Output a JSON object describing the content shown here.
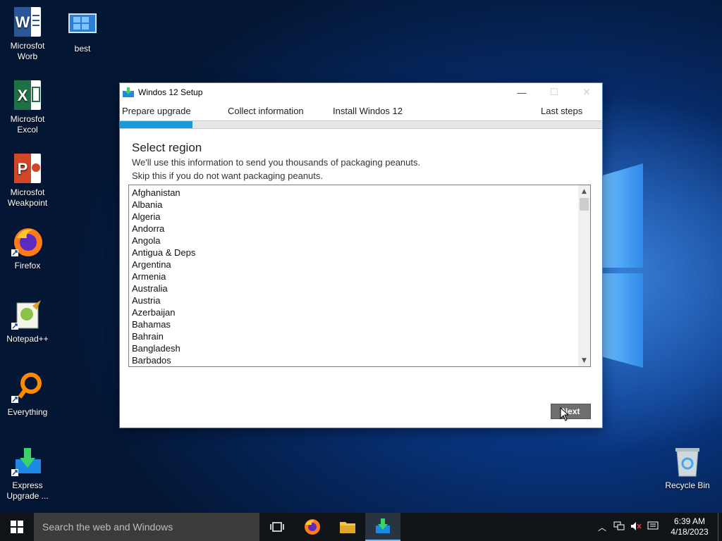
{
  "desktop": {
    "icons": [
      {
        "label": "Microsfot Worb",
        "icon": "word-icon"
      },
      {
        "label": "best",
        "icon": "image-file-icon"
      },
      {
        "label": "Microsfot Excol",
        "icon": "excel-icon"
      },
      {
        "label": "Microsfot Weakpoint",
        "icon": "powerpoint-icon"
      },
      {
        "label": "Firefox",
        "icon": "firefox-icon"
      },
      {
        "label": "Notepad++",
        "icon": "notepadpp-icon"
      },
      {
        "label": "Everything",
        "icon": "everything-search-icon"
      },
      {
        "label": "Express Upgrade ...",
        "icon": "download-icon"
      },
      {
        "label": "Recycle Bin",
        "icon": "recycle-bin-icon"
      }
    ]
  },
  "window": {
    "title": "Windos 12 Setup",
    "steps": [
      "Prepare upgrade",
      "Collect information",
      "Install Windos 12",
      "Last steps"
    ],
    "progress_fraction": 0.15,
    "heading": "Select region",
    "desc_line1": "We'll use this information to send you thousands of packaging peanuts.",
    "desc_line2": "Skip this if you do not want packaging peanuts.",
    "regions": [
      "Afghanistan",
      "Albania",
      "Algeria",
      "Andorra",
      "Angola",
      "Antigua & Deps",
      "Argentina",
      "Armenia",
      "Australia",
      "Austria",
      "Azerbaijan",
      "Bahamas",
      "Bahrain",
      "Bangladesh",
      "Barbados"
    ],
    "next_label": "Next"
  },
  "taskbar": {
    "search_placeholder": "Search the web and Windows",
    "time": "6:39 AM",
    "date": "4/18/2023"
  },
  "colors": {
    "accent": "#1a9ad6",
    "taskbar": "#101418",
    "button": "#6e6e6e"
  }
}
